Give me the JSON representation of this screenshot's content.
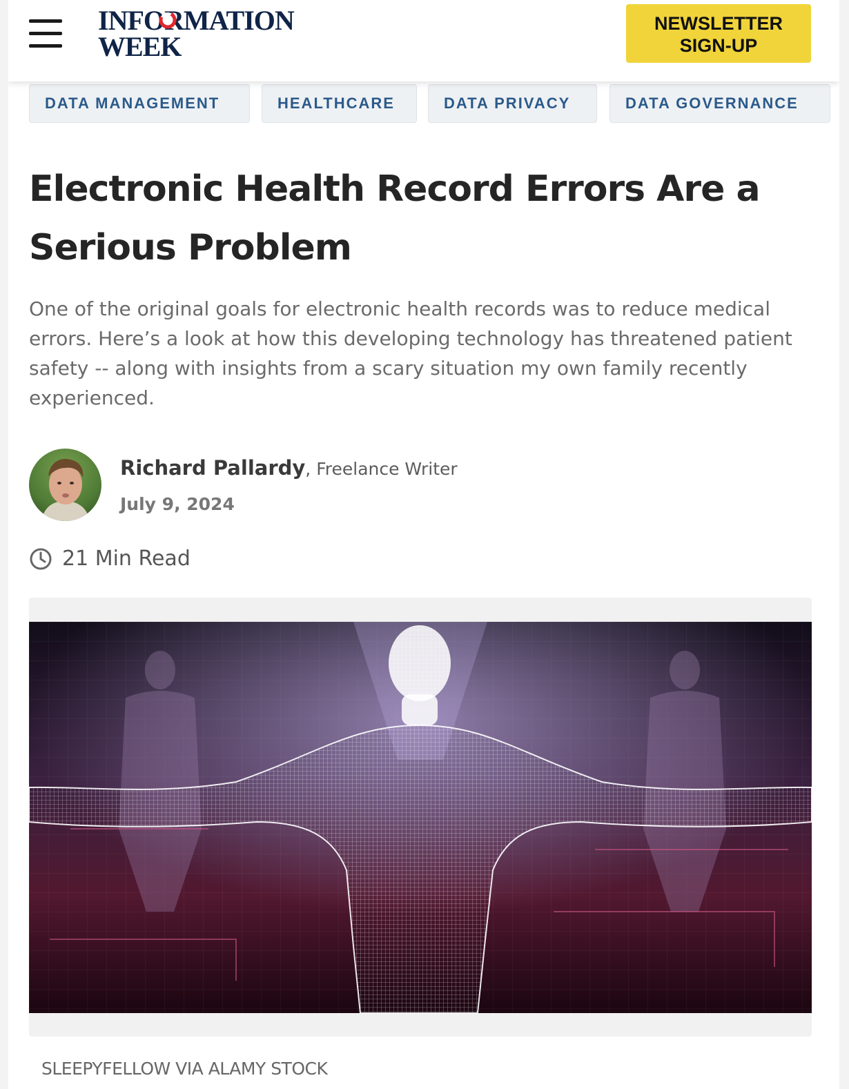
{
  "header": {
    "logo_line1": "INFORMATION",
    "logo_line2": "WEEK",
    "menu_icon": "hamburger-menu-icon",
    "newsletter_line1": "NEWSLETTER",
    "newsletter_line2": "SIGN-UP"
  },
  "tags": [
    "DATA MANAGEMENT",
    "HEALTHCARE",
    "DATA PRIVACY",
    "DATA GOVERNANCE"
  ],
  "article": {
    "title": "Electronic Health Record Errors Are a Serious Problem",
    "summary": "One of the original goals for electronic health records was to reduce medical errors. Here’s a look at how this developing technology has threatened patient safety -- along with insights from a scary situation my own family recently experienced.",
    "author_name": "Richard Pallardy",
    "author_role": ", Freelance Writer",
    "date": "July 9, 2024",
    "read_time": "21 Min Read",
    "image_caption": "SLEEPYFELLOW VIA ALAMY STOCK"
  },
  "colors": {
    "brand_navy": "#0f2447",
    "brand_red": "#e0282e",
    "newsletter_yellow": "#f0d43a",
    "tag_text": "#2b5a8a"
  }
}
